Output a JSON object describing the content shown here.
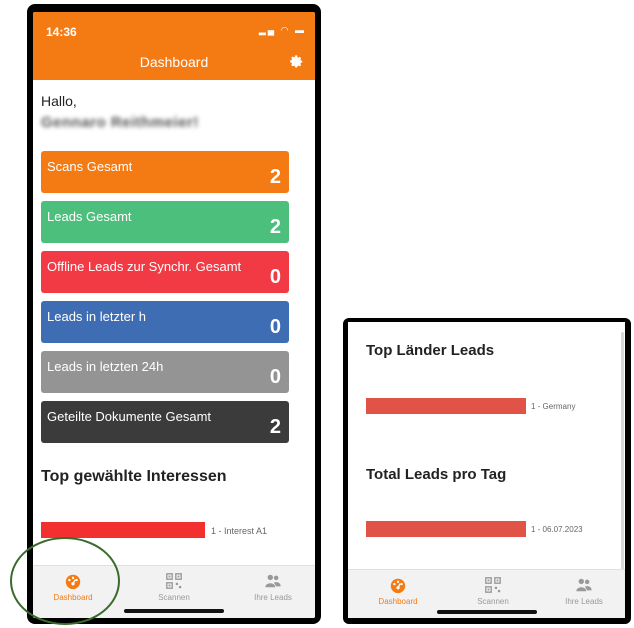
{
  "phone1": {
    "status_time": "14:36",
    "status_icons": "▂▄ ◠ ▬",
    "header_title": "Dashboard",
    "greeting": "Hallo,",
    "username": "Gennaro Reithmeier!",
    "tiles": [
      {
        "label": "Scans Gesamt",
        "value": "2",
        "color": "#f47b14"
      },
      {
        "label": "Leads Gesamt",
        "value": "2",
        "color": "#4cbf7c"
      },
      {
        "label": "Offline Leads zur Synchr. Gesamt",
        "value": "0",
        "color": "#f23a44"
      },
      {
        "label": "Leads in letzter h",
        "value": "0",
        "color": "#3f6db3"
      },
      {
        "label": "Leads in letzten 24h",
        "value": "0",
        "color": "#949494"
      },
      {
        "label": "Geteilte Dokumente Gesamt",
        "value": "2",
        "color": "#3b3b3b"
      }
    ],
    "interests_title": "Top gewählte Interessen",
    "interests_bar_label": "1 - Interest A1",
    "tabs": {
      "dashboard": "Dashboard",
      "scan": "Scannen",
      "leads": "Ihre Leads"
    }
  },
  "phone2": {
    "countries_title": "Top Länder Leads",
    "countries_bar_label": "1 - Germany",
    "perday_title": "Total Leads pro Tag",
    "perday_bar_label": "1 - 06.07.2023",
    "tabs": {
      "dashboard": "Dashboard",
      "scan": "Scannen",
      "leads": "Ihre Leads"
    }
  },
  "colors": {
    "accent": "#f47b14",
    "bar_red": "#f23030",
    "bar_red_muted": "#e05346",
    "tab_inactive": "#999999",
    "highlight_circle": "#3a6b2c"
  }
}
